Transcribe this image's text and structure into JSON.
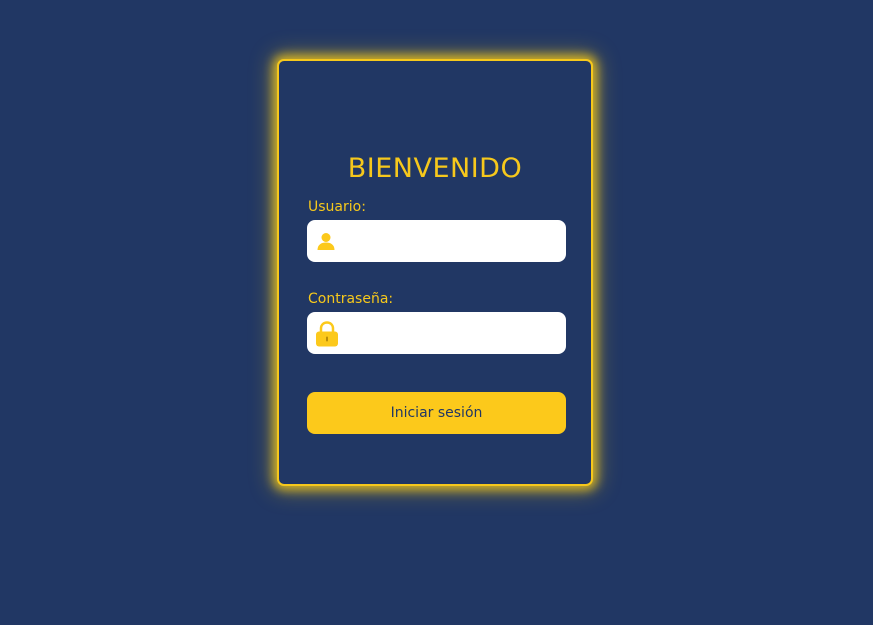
{
  "login": {
    "title": "BIENVENIDO",
    "username_label": "Usuario:",
    "username_value": "",
    "username_icon": "user-icon",
    "password_label": "Contraseña:",
    "password_value": "",
    "password_icon": "lock-icon",
    "submit_label": "Iniciar sesión"
  },
  "colors": {
    "background": "#213764",
    "accent": "#f6c81c",
    "field_background": "#ffffff"
  }
}
